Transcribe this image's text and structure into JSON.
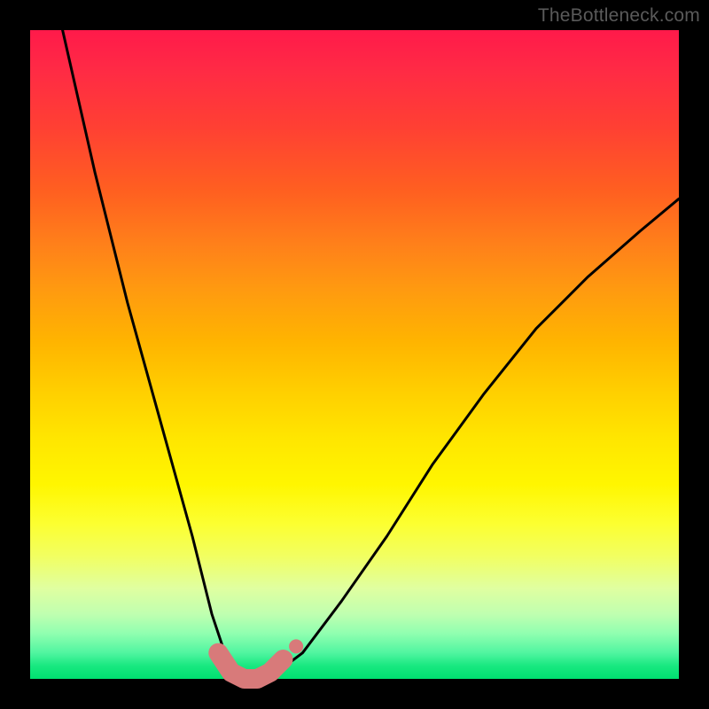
{
  "watermark_text": "TheBottleneck.com",
  "chart_data": {
    "type": "line",
    "title": "",
    "xlabel": "",
    "ylabel": "",
    "xlim": [
      0,
      100
    ],
    "ylim": [
      0,
      100
    ],
    "gradient_meaning": "vertical color gradient from red (top, ~100) to green (bottom, ~0) indicating bottleneck severity",
    "series": [
      {
        "name": "bottleneck-curve",
        "color": "#000000",
        "x": [
          5,
          10,
          15,
          20,
          25,
          28,
          30,
          32,
          34,
          36,
          38,
          42,
          48,
          55,
          62,
          70,
          78,
          86,
          94,
          100
        ],
        "y": [
          100,
          78,
          58,
          40,
          22,
          10,
          4,
          1,
          0,
          0,
          1,
          4,
          12,
          22,
          33,
          44,
          54,
          62,
          69,
          74
        ]
      },
      {
        "name": "highlight-flat-segment",
        "color": "#d87a7a",
        "x": [
          29,
          31,
          33,
          35,
          37,
          39
        ],
        "y": [
          4,
          1,
          0,
          0,
          1,
          3
        ]
      },
      {
        "name": "highlight-dot",
        "color": "#d87a7a",
        "x": [
          41
        ],
        "y": [
          5
        ]
      }
    ]
  }
}
